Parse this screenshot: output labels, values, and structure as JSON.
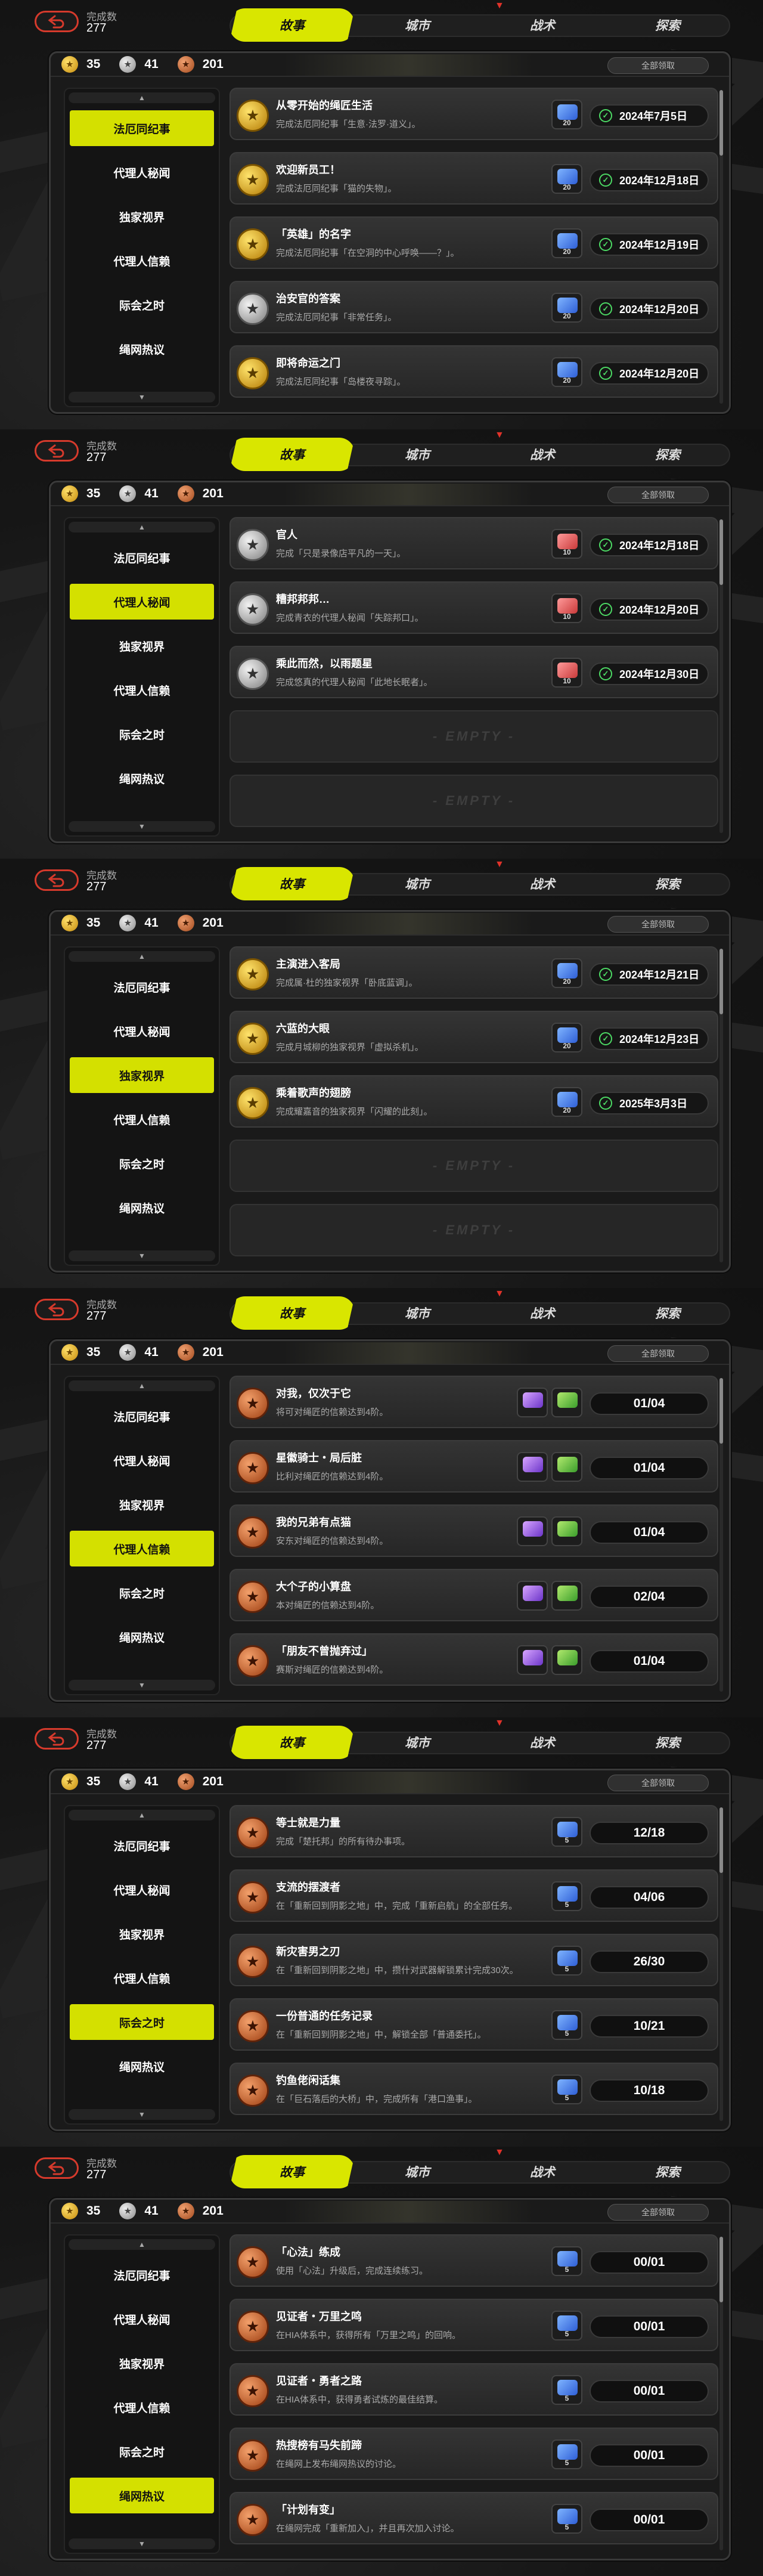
{
  "header": {
    "done_label": "完成数",
    "done_count": "277",
    "claim_all": "全部领取"
  },
  "tabs": [
    "故事",
    "城市",
    "战术",
    "探索"
  ],
  "currency": [
    "35",
    "41",
    "201"
  ],
  "sidebar": [
    "法厄同纪事",
    "代理人秘闻",
    "独家视界",
    "代理人信赖",
    "际会之时",
    "绳网热议"
  ],
  "empty_label": "- EMPTY -",
  "panels": [
    {
      "active_index": 0,
      "rows": [
        {
          "medal": "gold",
          "title": "从零开始的绳匠生活",
          "desc": "完成法厄同纪事「生意·法罗·道义」。",
          "reward": {
            "color": "blue",
            "num": "20"
          },
          "date": "2024年7月5日"
        },
        {
          "medal": "gold",
          "title": "欢迎新员工！",
          "desc": "完成法厄同纪事「猫的失物」。",
          "reward": {
            "color": "blue",
            "num": "20"
          },
          "date": "2024年12月18日"
        },
        {
          "medal": "gold",
          "title": "「英雄」的名字",
          "desc": "完成法厄同纪事「在空洞的中心呼唤——？」。",
          "reward": {
            "color": "blue",
            "num": "20"
          },
          "date": "2024年12月19日"
        },
        {
          "medal": "silver",
          "title": "治安官的答案",
          "desc": "完成法厄同纪事「非常任务」。",
          "reward": {
            "color": "blue",
            "num": "20"
          },
          "date": "2024年12月20日"
        },
        {
          "medal": "gold",
          "title": "即将命运之门",
          "desc": "完成法厄同纪事「岛楼夜寻踪」。",
          "reward": {
            "color": "blue",
            "num": "20"
          },
          "date": "2024年12月20日"
        }
      ]
    },
    {
      "active_index": 1,
      "rows": [
        {
          "medal": "silver",
          "title": "官人",
          "desc": "完成「只是录像店平凡的一天」。",
          "reward": {
            "color": "red",
            "num": "10"
          },
          "date": "2024年12月18日"
        },
        {
          "medal": "silver",
          "title": "糟邦邦邦…",
          "desc": "完成青衣的代理人秘闻「失踪邦口」。",
          "reward": {
            "color": "red",
            "num": "10"
          },
          "date": "2024年12月20日"
        },
        {
          "medal": "silver",
          "title": "乘此而然，以雨题星",
          "desc": "完成悠真的代理人秘闻「此地长眠者」。",
          "reward": {
            "color": "red",
            "num": "10"
          },
          "date": "2024年12月30日"
        }
      ],
      "empty": 2
    },
    {
      "active_index": 2,
      "rows": [
        {
          "medal": "gold",
          "title": "主演进入客局",
          "desc": "完成属·杜的独家视界「卧底蓝调」。",
          "reward": {
            "color": "blue",
            "num": "20"
          },
          "date": "2024年12月21日"
        },
        {
          "medal": "gold",
          "title": "六蓝的大眼",
          "desc": "完成月城柳的独家视界「虚拟杀机」。",
          "reward": {
            "color": "blue",
            "num": "20"
          },
          "date": "2024年12月23日"
        },
        {
          "medal": "gold",
          "title": "乘着歌声的翅膀",
          "desc": "完成耀嘉音的独家视界「闪耀的此刻」。",
          "reward": {
            "color": "blue",
            "num": "20"
          },
          "date": "2025年3月3日"
        }
      ],
      "empty": 2
    },
    {
      "active_index": 3,
      "rows": [
        {
          "medal": "bronze",
          "title": "对我，仅次于它",
          "desc": "将可对绳匠的信赖达到4阶。",
          "reward": {
            "color": "purple",
            "num": ""
          },
          "ticket": true,
          "progress": "01/04"
        },
        {
          "medal": "bronze",
          "title": "星徽骑士・局后脏",
          "desc": "比利对绳匠的信赖达到4阶。",
          "reward": {
            "color": "purple",
            "num": ""
          },
          "ticket": true,
          "progress": "01/04"
        },
        {
          "medal": "bronze",
          "title": "我的兄弟有点猫",
          "desc": "安东对绳匠的信赖达到4阶。",
          "reward": {
            "color": "purple",
            "num": ""
          },
          "ticket": true,
          "progress": "01/04"
        },
        {
          "medal": "bronze",
          "title": "大个子的小算盘",
          "desc": "本对绳匠的信赖达到4阶。",
          "reward": {
            "color": "purple",
            "num": ""
          },
          "ticket": true,
          "progress": "02/04"
        },
        {
          "medal": "bronze",
          "title": "「朋友不曾抛弃过」",
          "desc": "赛斯对绳匠的信赖达到4阶。",
          "reward": {
            "color": "purple",
            "num": ""
          },
          "ticket": true,
          "progress": "01/04"
        }
      ]
    },
    {
      "active_index": 4,
      "rows": [
        {
          "medal": "bronze",
          "title": "等士就是力量",
          "desc": "完成「楚托邦」的所有待办事项。",
          "reward": {
            "color": "blue",
            "num": "5"
          },
          "progress": "12/18"
        },
        {
          "medal": "bronze",
          "title": "支流的摆渡者",
          "desc": "在「重新回到阴影之地」中，完成「重新启航」的全部任务。",
          "reward": {
            "color": "blue",
            "num": "5"
          },
          "progress": "04/06"
        },
        {
          "medal": "bronze",
          "title": "新灾害男之刃",
          "desc": "在「重新回到阴影之地」中，攒什对武器解锁累计完成30次。",
          "reward": {
            "color": "blue",
            "num": "5"
          },
          "progress": "26/30"
        },
        {
          "medal": "bronze",
          "title": "一份普通的任务记录",
          "desc": "在「重新回到阴影之地」中，解锁全部「普通委托」。",
          "reward": {
            "color": "blue",
            "num": "5"
          },
          "progress": "10/21"
        },
        {
          "medal": "bronze",
          "title": "钓鱼佬闲话集",
          "desc": "在「巨石落后的大桥」中，完成所有「港口渔事」。",
          "reward": {
            "color": "blue",
            "num": "5"
          },
          "progress": "10/18"
        }
      ]
    },
    {
      "active_index": 5,
      "rows": [
        {
          "medal": "bronze",
          "title": "「心法」练成",
          "desc": "使用「心法」升级后，完成连续练习。",
          "reward": {
            "color": "blue",
            "num": "5"
          },
          "progress": "00/01"
        },
        {
          "medal": "bronze",
          "title": "见证者・万里之鸣",
          "desc": "在HIA体系中，获得所有「万里之鸣」的回响。",
          "reward": {
            "color": "blue",
            "num": "5"
          },
          "progress": "00/01"
        },
        {
          "medal": "bronze",
          "title": "见证者・勇者之路",
          "desc": "在HIA体系中，获得勇者试炼的最佳结算。",
          "reward": {
            "color": "blue",
            "num": "5"
          },
          "progress": "00/01"
        },
        {
          "medal": "bronze",
          "title": "热搜榜有马失前蹄",
          "desc": "在绳网上发布绳网热议的讨论。",
          "reward": {
            "color": "blue",
            "num": "5"
          },
          "progress": "00/01"
        },
        {
          "medal": "bronze",
          "title": "「计划有变」",
          "desc": "在绳网完成「重新加入」，并且再次加入讨论。",
          "reward": {
            "color": "blue",
            "num": "5"
          },
          "progress": "00/01"
        }
      ]
    }
  ]
}
